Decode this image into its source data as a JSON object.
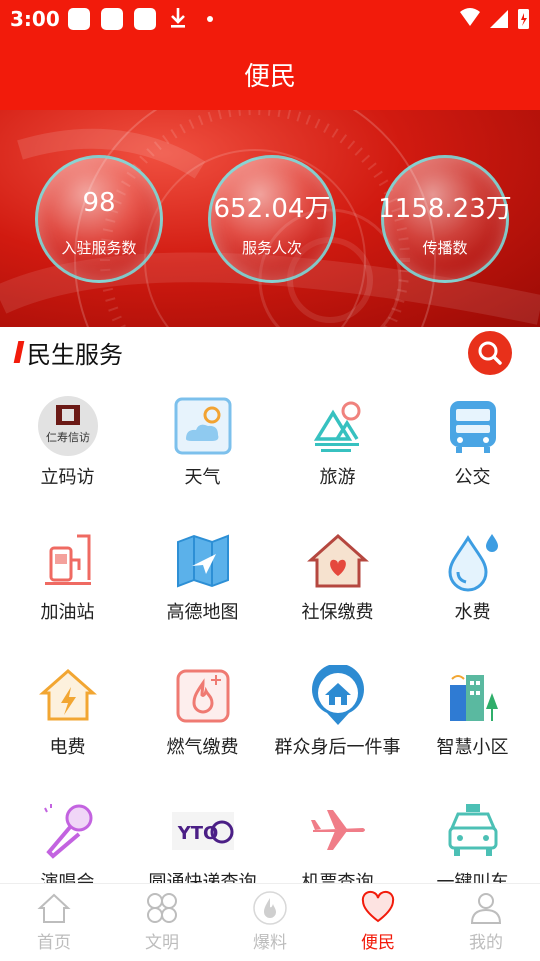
{
  "status_bar": {
    "time": "3:00"
  },
  "header": {
    "title": "便民"
  },
  "stats": [
    {
      "value": "98",
      "label": "入驻服务数"
    },
    {
      "value": "652.04万",
      "label": "服务人次"
    },
    {
      "value": "1158.23万",
      "label": "传播数"
    }
  ],
  "section": {
    "title": "民生服务"
  },
  "services": [
    {
      "label": "立码访",
      "icon": "visit-logo-icon",
      "logo_text": "仁寿信访"
    },
    {
      "label": "天气",
      "icon": "weather-icon"
    },
    {
      "label": "旅游",
      "icon": "travel-icon"
    },
    {
      "label": "公交",
      "icon": "bus-icon"
    },
    {
      "label": "加油站",
      "icon": "gas-station-icon"
    },
    {
      "label": "高德地图",
      "icon": "map-icon"
    },
    {
      "label": "社保缴费",
      "icon": "social-security-icon"
    },
    {
      "label": "水费",
      "icon": "water-drop-icon"
    },
    {
      "label": "电费",
      "icon": "electricity-icon"
    },
    {
      "label": "燃气缴费",
      "icon": "gas-fee-icon"
    },
    {
      "label": "群众身后一件事",
      "icon": "house-pin-icon"
    },
    {
      "label": "智慧小区",
      "icon": "smart-community-icon"
    },
    {
      "label": "演唱会",
      "icon": "microphone-icon"
    },
    {
      "label": "圆通快递查询",
      "icon": "yto-logo-icon",
      "logo_text": "YTO"
    },
    {
      "label": "机票查询",
      "icon": "airplane-icon"
    },
    {
      "label": "一键叫车",
      "icon": "taxi-icon"
    }
  ],
  "bottom_nav": [
    {
      "label": "首页",
      "icon": "home-icon",
      "active": false
    },
    {
      "label": "文明",
      "icon": "civilization-icon",
      "active": false
    },
    {
      "label": "爆料",
      "icon": "flame-icon",
      "active": false
    },
    {
      "label": "便民",
      "icon": "heart-icon",
      "active": true
    },
    {
      "label": "我的",
      "icon": "profile-icon",
      "active": false
    }
  ],
  "colors": {
    "primary": "#f21b0b",
    "nav_inactive": "#bdbdbd"
  }
}
